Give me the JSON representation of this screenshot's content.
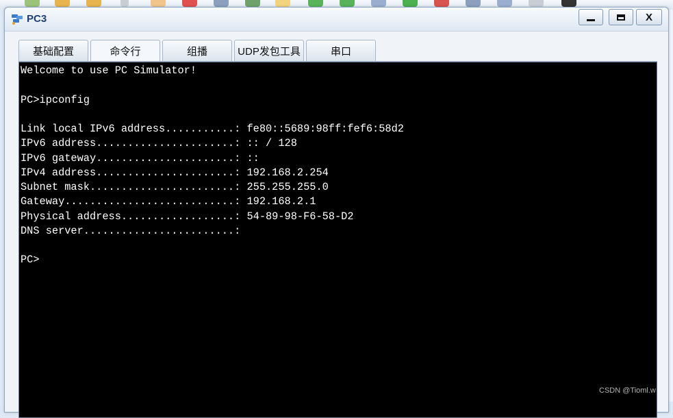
{
  "window": {
    "title": "PC3",
    "minimize": "",
    "maximize": "",
    "close": "X"
  },
  "tabs": [
    {
      "label": "基础配置"
    },
    {
      "label": "命令行"
    },
    {
      "label": "组播"
    },
    {
      "label": "UDP发包工具"
    },
    {
      "label": "串口"
    }
  ],
  "terminal": {
    "lines": [
      "Welcome to use PC Simulator!",
      "",
      "PC>ipconfig",
      "",
      "Link local IPv6 address...........: fe80::5689:98ff:fef6:58d2",
      "IPv6 address......................: :: / 128",
      "IPv6 gateway......................: ::",
      "IPv4 address......................: 192.168.2.254",
      "Subnet mask.......................: 255.255.255.0",
      "Gateway...........................: 192.168.2.1",
      "Physical address..................: 54-89-98-F6-58-D2",
      "DNS server........................:",
      "",
      "PC>"
    ]
  },
  "watermark": "CSDN @Tioml.w",
  "colors": {
    "terminal_bg": "#000000",
    "terminal_fg": "#ffffff",
    "title": "#1f3f73"
  }
}
